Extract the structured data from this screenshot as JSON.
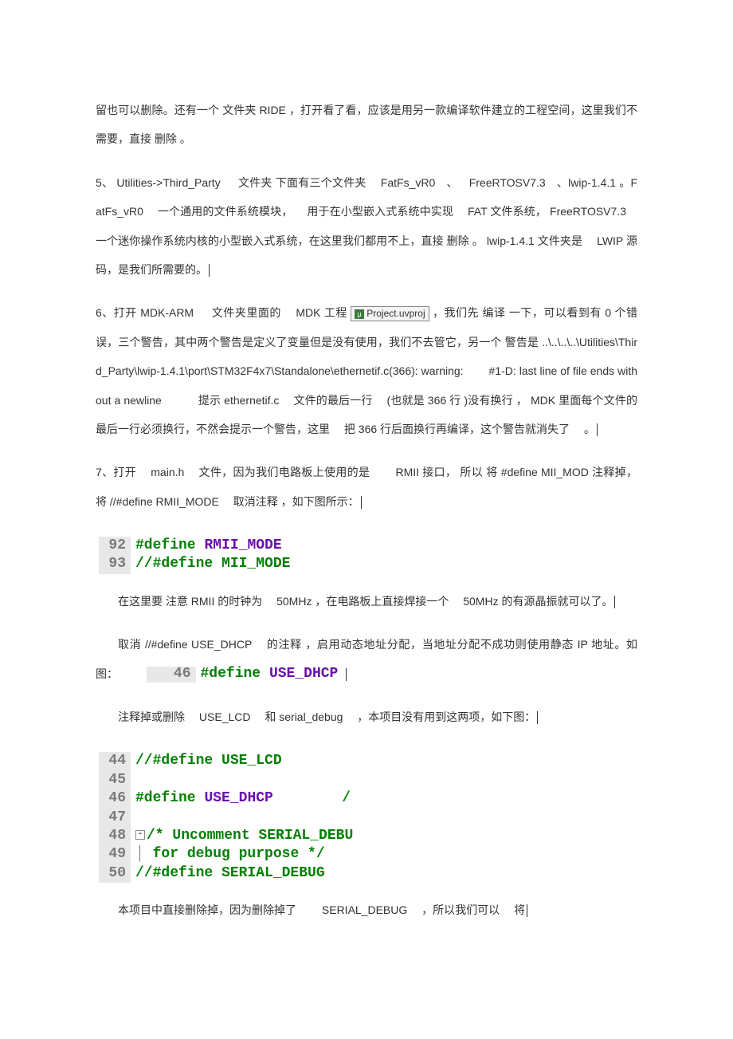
{
  "p1": "留也可以删除。还有一个 文件夹 RIDE ，打开看了看，应该是用另一款编译软件建立的工程空间，这里我们不需要，直接 删除 。",
  "p2": "5、 Utilities->Third_Party   文件夹 下面有三个文件夹  FatFs_vR0 、 FreeRTOSV7.3 、lwip-1.4.1 。FatFs_vR0  一个通用的文件系统模块，  用于在小型嵌入式系统中实现  FAT 文件系统， FreeRTOSV7.3  一个迷你操作系统内核的小型嵌入式系统，在这里我们都用不上，直接 删除 。 lwip-1.4.1  文件夹是  LWIP 源码，是我们所需要的。",
  "p3a": "6、打开 MDK-ARM   文件夹里面的  MDK 工程 ",
  "proj_label": "Project.uvproj",
  "p3b": " ，我们先 编译 一下，可以看到有 0 个错误，三个警告，其中两个警告是定义了变量但是没有使用，我们不去管它，另一个 警告是 ..\\..\\..\\..\\Utilities\\Third_Party\\lwip-1.4.1\\port\\STM32F4x7\\Standalone\\ethernetif.c(366): warning:   #1-D: last line of file ends without a newline    提示 ethernetif.c  文件的最后一行  (也就是 366 行 )没有换行 ， MDK  里面每个文件的最后一行必须换行，不然会提示一个警告，这里  把 366 行后面换行再编译，这个警告就消失了  。",
  "p4": "7、打开  main.h  文件，因为我们电路板上使用的是   RMII 接口， 所以 将 #define MII_MOD 注释掉，将  //#define RMII_MODE  取消注释 ，如下图所示：",
  "code1": {
    "l1_no": "92",
    "l1_kw": "#define",
    "l1_mac": "RMII_MODE",
    "l2_no": "93",
    "l2_cm": "//#define MII_MODE"
  },
  "p5": "在这里要 注意 RMII 的时钟为  50MHz ，在电路板上直接焊接一个  50MHz  的有源晶振就可以了。",
  "p6a": "取消 //#define USE_DHCP  的注释 ，启用动态地址分配，当地址分配不成功则使用静态 IP 地址。如图：",
  "inline_code": {
    "no": "46",
    "kw": "#define",
    "mac": "USE_DHCP"
  },
  "p7": "注释掉或删除  USE_LCD  和 serial_debug  ，本项目没有用到这两项，如下图：",
  "code2": {
    "l44_no": "44",
    "l44": "//#define USE_LCD",
    "l45_no": "45",
    "l46_no": "46",
    "l46_kw": "#define",
    "l46_mac": "USE_DHCP",
    "l46_end": "/",
    "l47_no": "47",
    "l48_no": "48",
    "l48a": "/* Uncomment SERIAL_DEBU",
    "l49_no": "49",
    "l49": "   for debug purpose */",
    "l50_no": "50",
    "l50": "//#define SERIAL_DEBUG"
  },
  "p8": "本项目中直接删除掉，因为删除掉了   SERIAL_DEBUG  ，所以我们可以  将"
}
